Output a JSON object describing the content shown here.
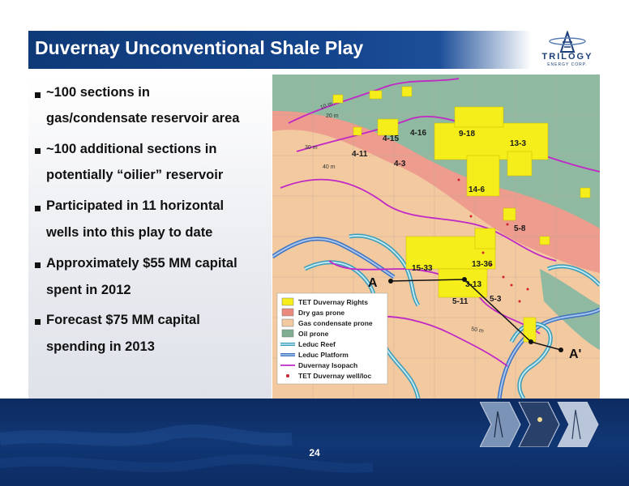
{
  "slide": {
    "title": "Duvernay Unconventional Shale Play",
    "page_number": "24",
    "logo": {
      "name": "TRILOGY",
      "subtitle": "ENERGY CORP."
    }
  },
  "bullets": [
    {
      "line1": "~100 sections in",
      "line2": "gas/condensate  reservoir area"
    },
    {
      "line1": "~100 additional sections in",
      "line2": "potentially “oilier” reservoir"
    },
    {
      "line1": "Participated in 11 horizontal",
      "line2": "wells into this play to date"
    },
    {
      "line1": "Approximately $55 MM capital",
      "line2": "spent in 2012"
    },
    {
      "line1": "Forecast $75 MM capital",
      "line2": "spending in 2013"
    }
  ],
  "map": {
    "well_labels": [
      "4-15",
      "4-16",
      "9-18",
      "13-3",
      "4-11",
      "4-3",
      "14-6",
      "5-8",
      "15-33",
      "13-36",
      "3-13",
      "5-11",
      "5-3"
    ],
    "contour_labels": [
      "10 m",
      "20 m",
      "30 m",
      "40 m",
      "50 m"
    ],
    "section_start": "A",
    "section_end": "A'",
    "legend": [
      {
        "label": "TET Duvernay Rights",
        "color": "#f5ee1a",
        "kind": "box"
      },
      {
        "label": "Dry gas prone",
        "color": "#e98a7c",
        "kind": "box"
      },
      {
        "label": "Gas condensate prone",
        "color": "#f3c9a0",
        "kind": "box"
      },
      {
        "label": "Oil prone",
        "color": "#7fae92",
        "kind": "box"
      },
      {
        "label": "Leduc Reef",
        "color": "#7fd3e6",
        "kind": "double-line"
      },
      {
        "label": "Leduc Platform",
        "color": "#5b8fd6",
        "kind": "double-line"
      },
      {
        "label": "Duvernay Isopach",
        "color": "#c028c6",
        "kind": "line"
      },
      {
        "label": "TET Duvernay well/loc",
        "color": "#d0222a",
        "kind": "dot"
      }
    ],
    "colors": {
      "oil_prone": "#8fb9a0",
      "gas_condensate": "#f3c9a0",
      "dry_gas": "#ee9c8e",
      "rights": "#f5ee1a",
      "isopach": "#c028c6",
      "reef": "#7fd3e6",
      "platform": "#5b8fd6",
      "well": "#d0222a"
    }
  }
}
